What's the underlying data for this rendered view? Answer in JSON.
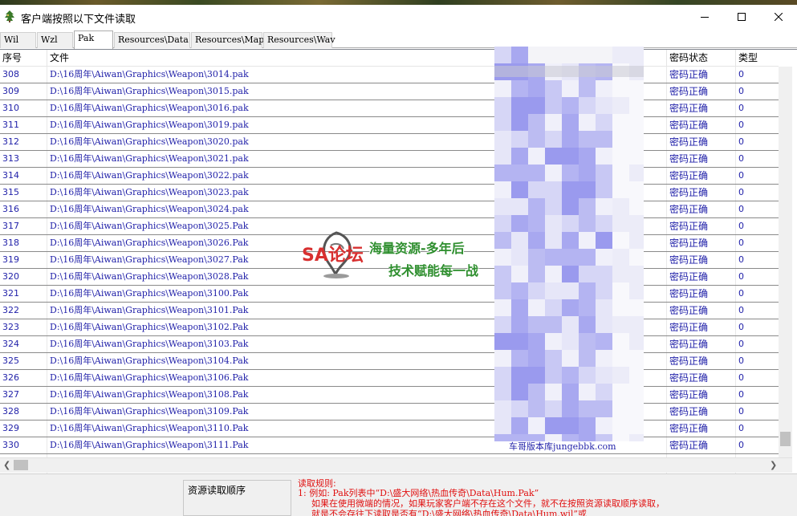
{
  "window": {
    "title": "客户端按照以下文件读取",
    "icon": "app-tree-icon"
  },
  "tabs": [
    {
      "label": "Wil",
      "active": false
    },
    {
      "label": "Wzl",
      "active": false
    },
    {
      "label": "Pak",
      "active": true
    },
    {
      "label": "Resources\\Data",
      "active": false
    },
    {
      "label": "Resources\\Map",
      "active": false
    },
    {
      "label": "Resources\\Wav",
      "active": false
    }
  ],
  "table": {
    "columns": [
      "序号",
      "文件",
      "密码状态",
      "类型"
    ],
    "rows": [
      {
        "idx": "308",
        "file": "D:\\16周年\\Aiwan\\Graphics\\Weapon\\3014.pak",
        "status": "密码正确",
        "type": "0"
      },
      {
        "idx": "309",
        "file": "D:\\16周年\\Aiwan\\Graphics\\Weapon\\3015.pak",
        "status": "密码正确",
        "type": "0"
      },
      {
        "idx": "310",
        "file": "D:\\16周年\\Aiwan\\Graphics\\Weapon\\3016.pak",
        "status": "密码正确",
        "type": "0"
      },
      {
        "idx": "311",
        "file": "D:\\16周年\\Aiwan\\Graphics\\Weapon\\3019.pak",
        "status": "密码正确",
        "type": "0"
      },
      {
        "idx": "312",
        "file": "D:\\16周年\\Aiwan\\Graphics\\Weapon\\3020.pak",
        "status": "密码正确",
        "type": "0"
      },
      {
        "idx": "313",
        "file": "D:\\16周年\\Aiwan\\Graphics\\Weapon\\3021.pak",
        "status": "密码正确",
        "type": "0"
      },
      {
        "idx": "314",
        "file": "D:\\16周年\\Aiwan\\Graphics\\Weapon\\3022.pak",
        "status": "密码正确",
        "type": "0"
      },
      {
        "idx": "315",
        "file": "D:\\16周年\\Aiwan\\Graphics\\Weapon\\3023.pak",
        "status": "密码正确",
        "type": "0"
      },
      {
        "idx": "316",
        "file": "D:\\16周年\\Aiwan\\Graphics\\Weapon\\3024.pak",
        "status": "密码正确",
        "type": "0"
      },
      {
        "idx": "317",
        "file": "D:\\16周年\\Aiwan\\Graphics\\Weapon\\3025.Pak",
        "status": "密码正确",
        "type": "0"
      },
      {
        "idx": "318",
        "file": "D:\\16周年\\Aiwan\\Graphics\\Weapon\\3026.Pak",
        "status": "密码正确",
        "type": "0"
      },
      {
        "idx": "319",
        "file": "D:\\16周年\\Aiwan\\Graphics\\Weapon\\3027.Pak",
        "status": "密码正确",
        "type": "0"
      },
      {
        "idx": "320",
        "file": "D:\\16周年\\Aiwan\\Graphics\\Weapon\\3028.Pak",
        "status": "密码正确",
        "type": "0"
      },
      {
        "idx": "321",
        "file": "D:\\16周年\\Aiwan\\Graphics\\Weapon\\3100.Pak",
        "status": "密码正确",
        "type": "0"
      },
      {
        "idx": "322",
        "file": "D:\\16周年\\Aiwan\\Graphics\\Weapon\\3101.Pak",
        "status": "密码正确",
        "type": "0"
      },
      {
        "idx": "323",
        "file": "D:\\16周年\\Aiwan\\Graphics\\Weapon\\3102.Pak",
        "status": "密码正确",
        "type": "0"
      },
      {
        "idx": "324",
        "file": "D:\\16周年\\Aiwan\\Graphics\\Weapon\\3103.Pak",
        "status": "密码正确",
        "type": "0"
      },
      {
        "idx": "325",
        "file": "D:\\16周年\\Aiwan\\Graphics\\Weapon\\3104.Pak",
        "status": "密码正确",
        "type": "0"
      },
      {
        "idx": "326",
        "file": "D:\\16周年\\Aiwan\\Graphics\\Weapon\\3106.Pak",
        "status": "密码正确",
        "type": "0"
      },
      {
        "idx": "327",
        "file": "D:\\16周年\\Aiwan\\Graphics\\Weapon\\3108.Pak",
        "status": "密码正确",
        "type": "0"
      },
      {
        "idx": "328",
        "file": "D:\\16周年\\Aiwan\\Graphics\\Weapon\\3109.Pak",
        "status": "密码正确",
        "type": "0"
      },
      {
        "idx": "329",
        "file": "D:\\16周年\\Aiwan\\Graphics\\Weapon\\3110.Pak",
        "status": "密码正确",
        "type": "0"
      },
      {
        "idx": "330",
        "file": "D:\\16周年\\Aiwan\\Graphics\\Weapon\\3111.Pak",
        "status": "密码正确",
        "type": "0"
      }
    ],
    "partial_credit_text": "车哥版本库jungebbk.com"
  },
  "watermark": {
    "logo": "SA论坛",
    "line1": "海量资源-多年后",
    "line2": "技术赋能每一战"
  },
  "bottom": {
    "order_label": "资源读取顺序",
    "rules_title": "读取规则:",
    "rules_lines": [
      "1: 例如: Pak列表中“D:\\盛大网络\\热血传奇\\Data\\Hum.Pak”",
      "如果在使用微端的情况，如果玩家客户端不存在这个文件，就不在按照资源读取顺序读取，",
      "就是不会存往下读取是否有“D:\\盛大网络\\热血传奇\\Data\\Hum.wil”或"
    ]
  },
  "colors": {
    "link_blue": "#1f1fa8",
    "rule_red": "#e01010",
    "mask_blue": "#8e8ef0"
  }
}
